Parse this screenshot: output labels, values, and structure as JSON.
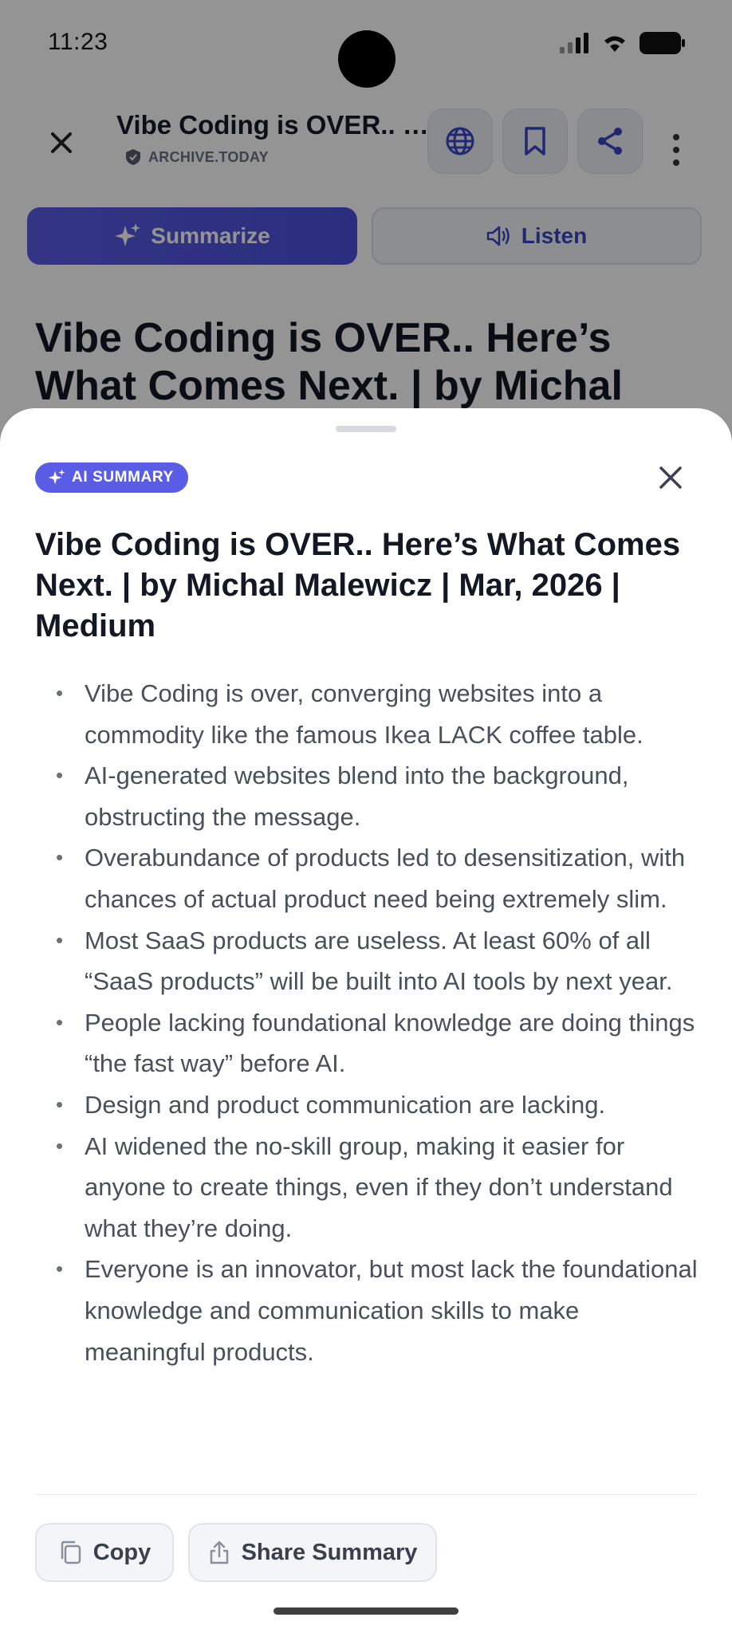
{
  "status_bar": {
    "time": "11:23"
  },
  "header": {
    "title": "Vibe Coding is OVER.. …",
    "source": "ARCHIVE.TODAY"
  },
  "actions": {
    "summarize": "Summarize",
    "listen": "Listen"
  },
  "article": {
    "heading": "Vibe Coding is OVER.. Here’s What Comes Next. | by Michal Malewicz |"
  },
  "summary_sheet": {
    "badge": "AI SUMMARY",
    "title": "Vibe Coding is OVER.. Here’s What Comes Next. | by Michal Malewicz | Mar, 2026 | Medium",
    "bullets": [
      "Vibe Coding is over, converging websites into a commodity like the famous Ikea LACK coffee table.",
      "AI-generated websites blend into the background, obstructing the message.",
      "Overabundance of products led to desensitization, with chances of actual product need being extremely slim.",
      "Most SaaS products are useless. At least 60% of all “SaaS products” will be built into AI tools by next year.",
      "People lacking foundational knowledge are doing things “the fast way” before AI.",
      "Design and product communication are lacking.",
      "AI widened the no-skill group, making it easier for anyone to create things, even if they don’t understand what they’re doing.",
      "Everyone is an innovator, but most lack the foundational knowledge and communication skills to make meaningful products."
    ],
    "copy_label": "Copy",
    "share_label": "Share Summary"
  },
  "colors": {
    "accent": "#5b5ce6",
    "accent_text": "#3b45c2",
    "scrim": "rgba(0,0,0,0.42)"
  },
  "icons": [
    "close-icon",
    "shield-icon",
    "globe-icon",
    "bookmark-icon",
    "share-icon",
    "more-vertical-icon",
    "sparkle-icon",
    "speaker-icon",
    "copy-icon",
    "upload-icon"
  ]
}
